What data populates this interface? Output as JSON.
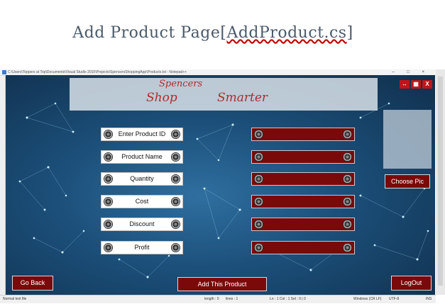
{
  "document": {
    "heading": "Add Product Page",
    "heading_link": "AddProduct.cs"
  },
  "notepad": {
    "title": "C:\\Users\\Toppers at Top\\Documents\\Visual Studio 2010\\Projects\\SpencersShoppingApp\\Products.txt - Notepad++",
    "status": {
      "type": "Normal text file",
      "length": "length : 0",
      "lines": "lines : 1",
      "position": "Ln : 1   Col : 1   Sel : 0 | 0",
      "eol": "Windows (CR LF)",
      "encoding": "UTF-8",
      "mode": "INS"
    }
  },
  "app": {
    "banner": {
      "word1": "Shop",
      "word2": "Spencers",
      "word3": "Smarter"
    },
    "window_buttons": {
      "swap": "↔",
      "grid": "▦",
      "close": "X"
    },
    "fields": [
      {
        "label": "Enter Product ID",
        "value": ""
      },
      {
        "label": "Product Name",
        "value": ""
      },
      {
        "label": "Quantity",
        "value": ""
      },
      {
        "label": "Cost",
        "value": ""
      },
      {
        "label": "Discount",
        "value": ""
      },
      {
        "label": "Profit",
        "value": ""
      }
    ],
    "buttons": {
      "choose_pic": "Choose Pic",
      "go_back": "Go Back",
      "add_product": "Add This Product",
      "logout": "LogOut"
    },
    "colors": {
      "accent": "#7a0a0a",
      "close": "#c0141b",
      "background": "#1b4e78"
    }
  }
}
